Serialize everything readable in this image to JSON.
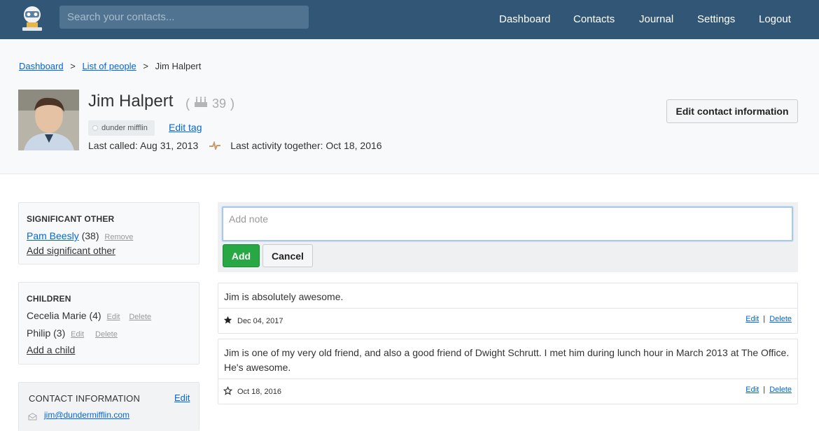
{
  "topbar": {
    "search_placeholder": "Search your contacts...",
    "nav": [
      "Dashboard",
      "Contacts",
      "Journal",
      "Settings",
      "Logout"
    ]
  },
  "breadcrumb": {
    "dashboard": "Dashboard",
    "sep1": ">",
    "list": "List of people",
    "sep2": ">",
    "current": "Jim Halpert"
  },
  "contact": {
    "name": "Jim Halpert",
    "age": "39",
    "tag": "dunder mifflin",
    "edit_tag": "Edit tag",
    "last_called": "Last called: Aug 31, 2013",
    "last_activity": "Last activity together: Oct 18, 2016",
    "edit_button": "Edit contact information"
  },
  "significant_other": {
    "title": "SIGNIFICANT OTHER",
    "name": "Pam Beesly",
    "age": "(38)",
    "remove": "Remove",
    "add": "Add significant other"
  },
  "children": {
    "title": "CHILDREN",
    "items": [
      {
        "name": "Cecelia Marie",
        "age": "(4)",
        "edit": "Edit",
        "delete": "Delete"
      },
      {
        "name": "Philip",
        "age": "(3)",
        "edit": "Edit",
        "delete": "Delete"
      }
    ],
    "add": "Add a child"
  },
  "contact_info": {
    "title": "CONTACT INFORMATION",
    "edit": "Edit",
    "email": "jim@dundermifflin.com"
  },
  "note_form": {
    "placeholder": "Add note",
    "add": "Add",
    "cancel": "Cancel"
  },
  "notes": [
    {
      "text": "Jim is absolutely awesome.",
      "date": "Dec 04, 2017",
      "favorite": true,
      "edit": "Edit",
      "sep": "|",
      "delete": "Delete"
    },
    {
      "text": "Jim is one of my very old friend, and also a good friend of Dwight Schrutt. I met him during lunch hour in March 2013 at The Office. He's awesome.",
      "date": "Oct 18, 2016",
      "favorite": false,
      "edit": "Edit",
      "sep": "|",
      "delete": "Delete"
    }
  ],
  "colors": {
    "topbar": "#325776",
    "link": "#0366d6",
    "add_button": "#28a745"
  },
  "icons": [
    "app-logo-icon",
    "birthday-cake-icon",
    "tag-dot-icon",
    "activity-icon",
    "star-filled-icon",
    "star-outline-icon",
    "envelope-icon"
  ]
}
